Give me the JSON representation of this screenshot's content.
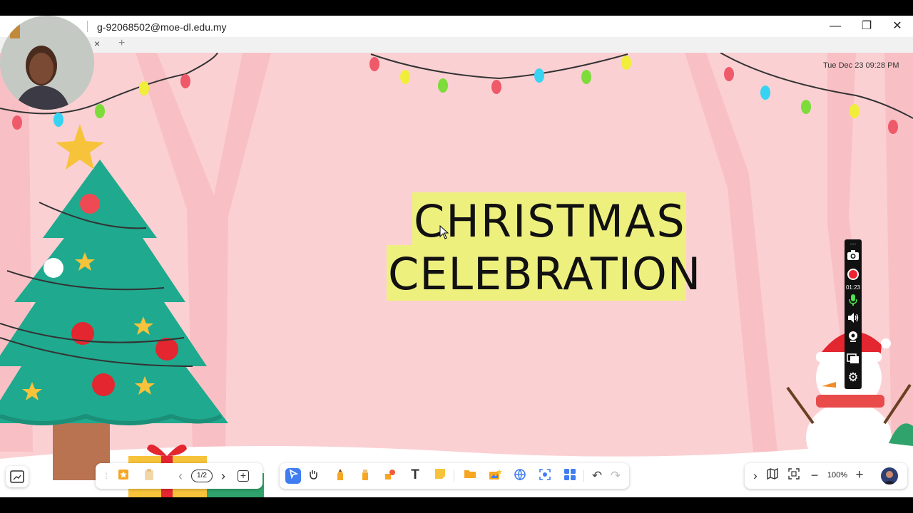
{
  "window": {
    "account": "g-92068502@moe-dl.edu.my",
    "minimize": "—",
    "restore": "❐",
    "close": "✕"
  },
  "tabs": {
    "close": "×",
    "add": "+"
  },
  "canvas": {
    "datetime": "Tue Dec 23  09:28 PM",
    "title_line1": "CHRISTMAS",
    "title_line2": "CELEBRATION",
    "highlight_color": "#eef07e",
    "background_color": "#fbd0d3"
  },
  "recorder": {
    "timer": "01:23",
    "icons": [
      "pin-icon",
      "camera-icon",
      "record-icon",
      "microphone-icon",
      "speaker-icon",
      "webcam-icon",
      "screen-icon",
      "settings-icon"
    ]
  },
  "page_nav": {
    "page": "1/2",
    "prev": "‹",
    "next": "›",
    "add": "+"
  },
  "tools": [
    "select",
    "hand",
    "pen",
    "highlighter",
    "shapes",
    "text",
    "sticky-note",
    "folder",
    "media",
    "browser",
    "screenshot",
    "apps",
    "undo",
    "redo"
  ],
  "view": {
    "zoom": "100%",
    "zoom_out": "−",
    "zoom_in": "+",
    "expand": "›"
  }
}
